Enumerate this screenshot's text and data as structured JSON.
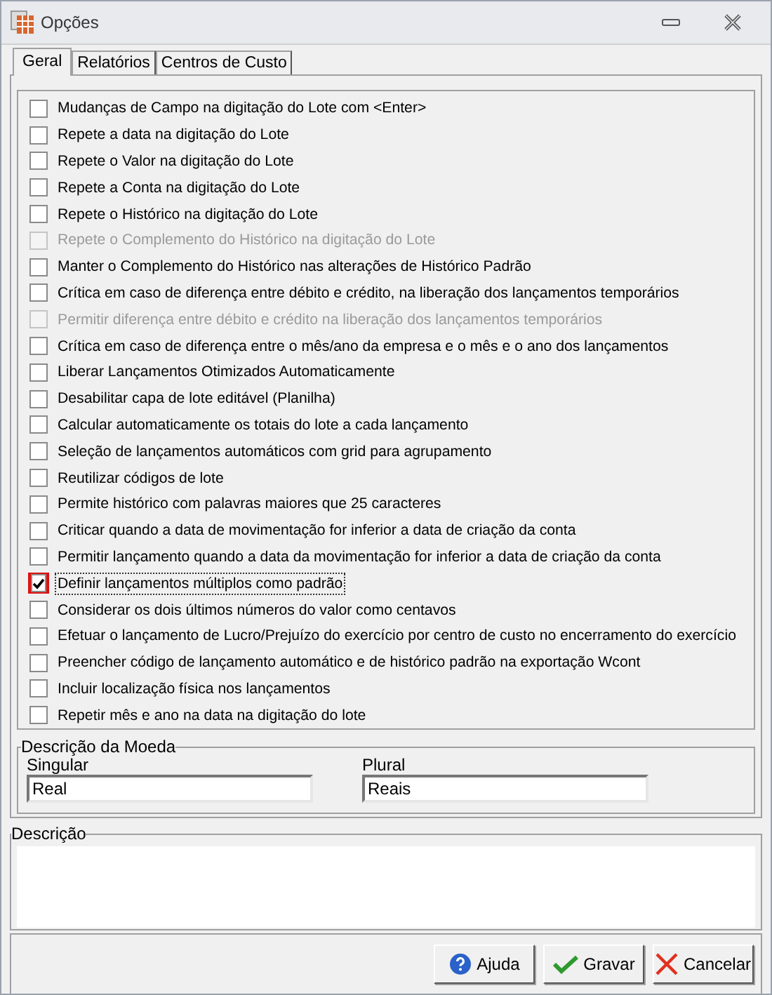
{
  "window": {
    "title": "Opções"
  },
  "tabs": [
    {
      "label": "Geral",
      "selected": true
    },
    {
      "label": "Relatórios",
      "selected": false
    },
    {
      "label": "Centros de Custo",
      "selected": false
    }
  ],
  "options": [
    {
      "label": "Mudanças de Campo na digitação do Lote com <Enter>",
      "checked": false,
      "disabled": false,
      "focused": false
    },
    {
      "label": "Repete a data na digitação do Lote",
      "checked": false,
      "disabled": false,
      "focused": false
    },
    {
      "label": "Repete o Valor na digitação do Lote",
      "checked": false,
      "disabled": false,
      "focused": false
    },
    {
      "label": "Repete a Conta na digitação do Lote",
      "checked": false,
      "disabled": false,
      "focused": false
    },
    {
      "label": "Repete o Histórico na digitação do Lote",
      "checked": false,
      "disabled": false,
      "focused": false
    },
    {
      "label": "Repete o Complemento do Histórico na digitação do Lote",
      "checked": false,
      "disabled": true,
      "focused": false
    },
    {
      "label": "Manter o Complemento do Histórico nas alterações de Histórico Padrão",
      "checked": false,
      "disabled": false,
      "focused": false
    },
    {
      "label": "Crítica em caso de diferença entre débito e crédito, na liberação dos lançamentos temporários",
      "checked": false,
      "disabled": false,
      "focused": false
    },
    {
      "label": "Permitir diferença entre débito e crédito na liberação dos lançamentos temporários",
      "checked": false,
      "disabled": true,
      "focused": false
    },
    {
      "label": "Crítica em caso de diferença entre o mês/ano da empresa e o mês e o ano dos lançamentos",
      "checked": false,
      "disabled": false,
      "focused": false
    },
    {
      "label": "Liberar Lançamentos Otimizados Automaticamente",
      "checked": false,
      "disabled": false,
      "focused": false
    },
    {
      "label": "Desabilitar capa de lote editável (Planilha)",
      "checked": false,
      "disabled": false,
      "focused": false
    },
    {
      "label": "Calcular automaticamente os totais do lote a cada lançamento",
      "checked": false,
      "disabled": false,
      "focused": false
    },
    {
      "label": "Seleção de lançamentos automáticos com grid para agrupamento",
      "checked": false,
      "disabled": false,
      "focused": false
    },
    {
      "label": "Reutilizar códigos de lote",
      "checked": false,
      "disabled": false,
      "focused": false
    },
    {
      "label": "Permite histórico com palavras maiores que 25 caracteres",
      "checked": false,
      "disabled": false,
      "focused": false
    },
    {
      "label": "Criticar quando a data de movimentação for inferior a data de criação da conta",
      "checked": false,
      "disabled": false,
      "focused": false
    },
    {
      "label": "Permitir lançamento quando a data da movimentação for inferior a data de criação da conta",
      "checked": false,
      "disabled": false,
      "focused": false
    },
    {
      "label": "Definir lançamentos múltiplos como padrão",
      "checked": true,
      "disabled": false,
      "focused": true
    },
    {
      "label": "Considerar os dois últimos números do valor como centavos",
      "checked": false,
      "disabled": false,
      "focused": false
    },
    {
      "label": "Efetuar o lançamento de Lucro/Prejuízo do exercício por centro de custo no encerramento do exercício",
      "checked": false,
      "disabled": false,
      "focused": false
    },
    {
      "label": "Preencher código de lançamento automático e de histórico padrão na exportação Wcont",
      "checked": false,
      "disabled": false,
      "focused": false
    },
    {
      "label": "Incluir localização física nos lançamentos",
      "checked": false,
      "disabled": false,
      "focused": false
    },
    {
      "label": "Repetir mês e ano na data na digitação do lote",
      "checked": false,
      "disabled": false,
      "focused": false
    }
  ],
  "currency": {
    "title": "Descrição da Moeda",
    "singular": {
      "label": "Singular",
      "value": "Real"
    },
    "plural": {
      "label": "Plural",
      "value": "Reais"
    }
  },
  "description": {
    "title": "Descrição"
  },
  "buttons": [
    {
      "kind": "help",
      "label": "Ajuda"
    },
    {
      "kind": "save",
      "label": "Gravar"
    },
    {
      "kind": "cancel",
      "label": "Cancelar"
    }
  ]
}
